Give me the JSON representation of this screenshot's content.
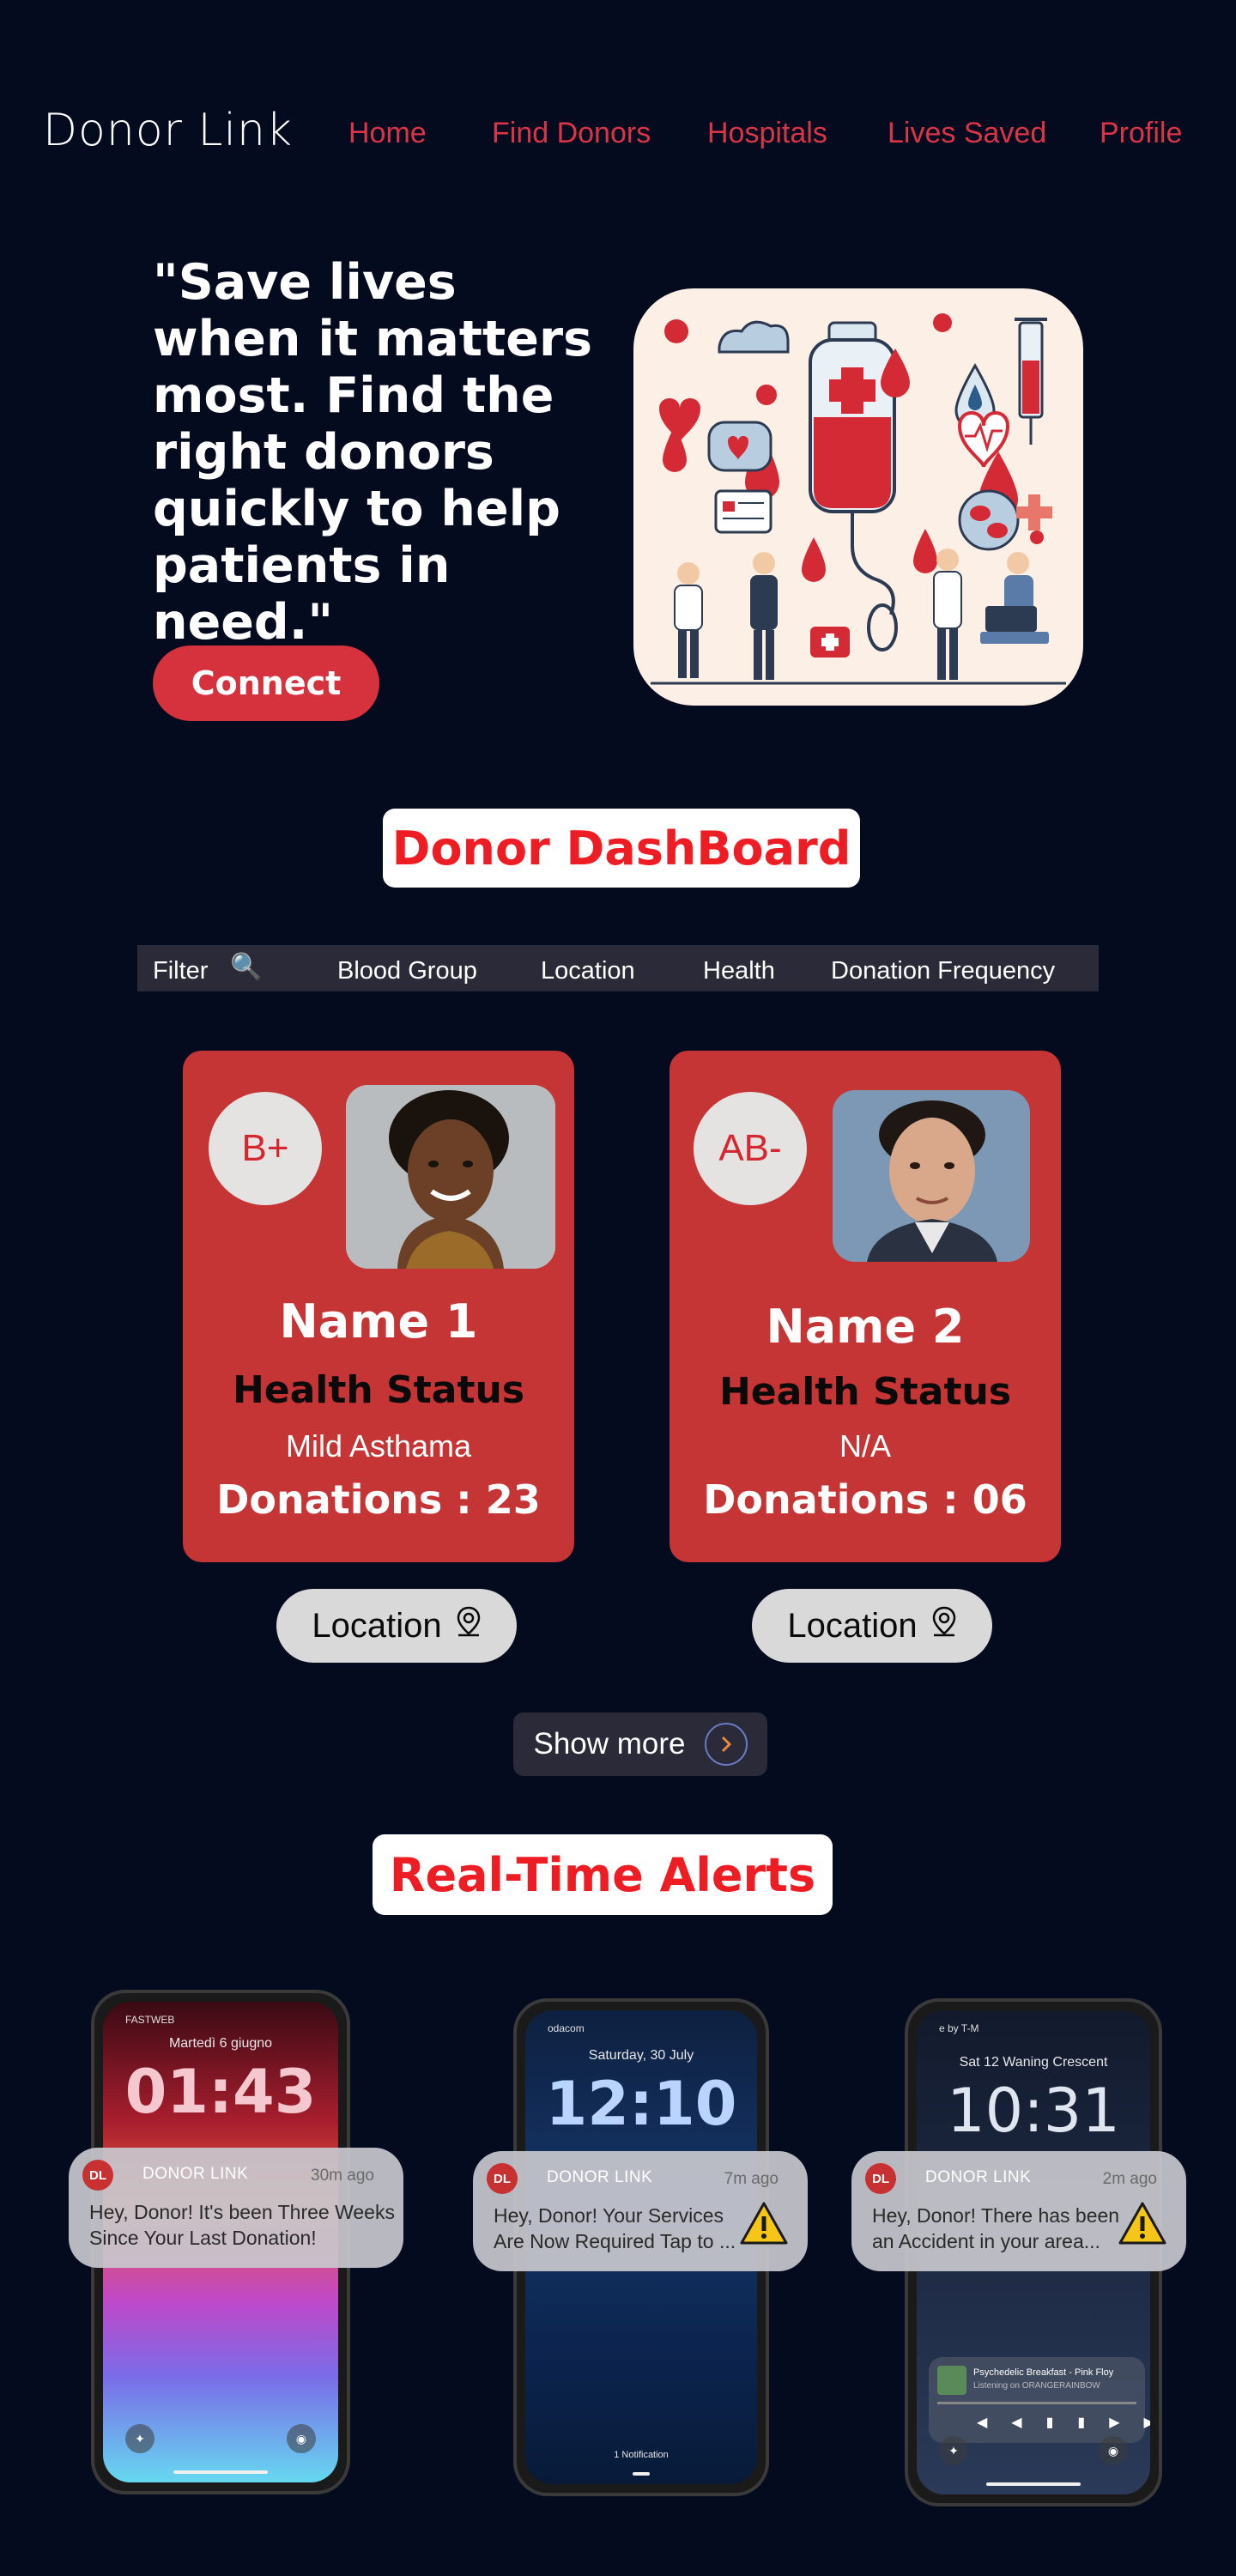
{
  "nav": {
    "logo": "Donor Link",
    "links": [
      "Home",
      "Find Donors",
      "Hospitals",
      "Lives Saved",
      "Profile"
    ]
  },
  "hero": {
    "quote": "\"Save lives when it matters most. Find the right donors quickly to help patients in need.\"",
    "connect_label": "Connect"
  },
  "dashboard": {
    "title": "Donor DashBoard",
    "filter": {
      "label": "Filter",
      "options": [
        "Blood Group",
        "Location",
        "Health",
        "Donation Frequency"
      ]
    },
    "cards": [
      {
        "blood_group": "B+",
        "name": "Name 1",
        "health_label": "Health Status",
        "condition": "Mild Asthama",
        "donations": "Donations : 23",
        "location_label": "Location"
      },
      {
        "blood_group": "AB-",
        "name": "Name 2",
        "health_label": "Health Status",
        "condition": "N/A",
        "donations": "Donations : 06",
        "location_label": "Location"
      }
    ],
    "show_more_label": "Show more"
  },
  "alerts": {
    "title": "Real-Time Alerts",
    "phones": [
      {
        "status": "FASTWEB",
        "date": "Martedì 6 giugno",
        "time": "01:43",
        "notif": {
          "badge": "DL",
          "app": "DONOR LINK",
          "ago": "30m ago",
          "message": "Hey, Donor! It's been Three Weeks Since Your Last Donation!"
        }
      },
      {
        "status": "odacom",
        "date": "Saturday, 30 July",
        "time": "12:10",
        "footer": "1 Notification",
        "notif": {
          "badge": "DL",
          "app": "DONOR LINK",
          "ago": "7m ago",
          "message": "Hey, Donor! Your Services Are Now Required Tap to ..."
        }
      },
      {
        "status": "e by T-M",
        "date": "Sat 12  Waning Crescent",
        "time": "10:31",
        "music_title": "Psychedelic Breakfast - Pink Floy",
        "music_sub": "Listening on ORANGERAINBOW",
        "notif": {
          "badge": "DL",
          "app": "DONOR LINK",
          "ago": "2m ago",
          "message": "Hey, Donor! There has been an Accident in your area..."
        }
      }
    ]
  },
  "colors": {
    "background": "#050b1f",
    "accent_red": "#d5323d",
    "card_red": "#c53535",
    "title_red": "#ee1d23",
    "nav_link": "#d93546"
  }
}
